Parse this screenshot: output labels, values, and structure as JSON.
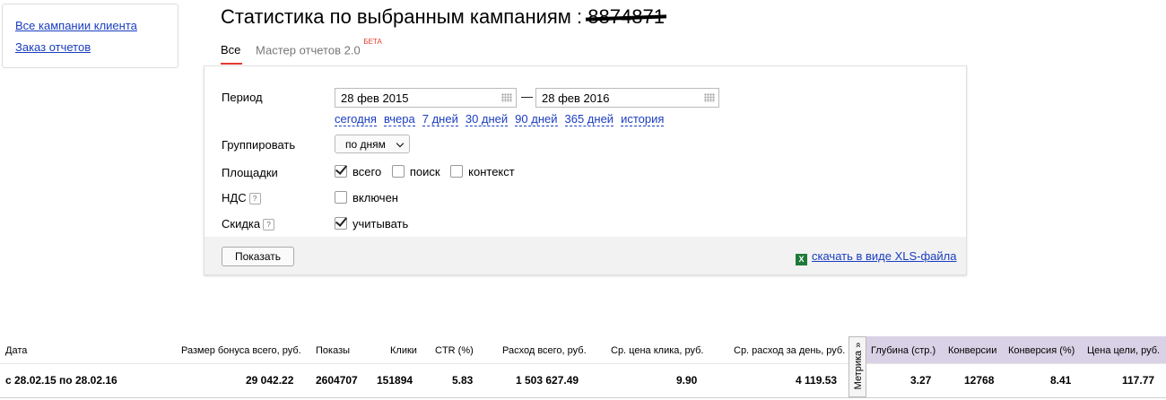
{
  "sidebar": {
    "links": [
      "Все кампании клиента",
      "Заказ отчетов"
    ]
  },
  "header": {
    "title": "Статистика по выбранным кампаниям :",
    "redacted_id": "8874871"
  },
  "tabs": {
    "active": "Все",
    "master": "Мастер отчетов 2.0",
    "master_badge": "БЕТА"
  },
  "form": {
    "period_label": "Период",
    "date_from": "28 фев 2015",
    "date_to": "28 фев 2016",
    "dash": "—",
    "quick_links": [
      "сегодня",
      "вчера",
      "7 дней",
      "30 дней",
      "90 дней",
      "365 дней",
      "история"
    ],
    "group_label": "Группировать",
    "group_value": "по дням",
    "platforms_label": "Площадки",
    "platforms": [
      {
        "label": "всего",
        "checked": true
      },
      {
        "label": "поиск",
        "checked": false
      },
      {
        "label": "контекст",
        "checked": false
      }
    ],
    "vat_label": "НДС",
    "vat_option": "включен",
    "discount_label": "Скидка",
    "discount_option": "учитывать",
    "help_glyph": "?",
    "show_button": "Показать",
    "xls_link": "скачать в виде XLS-файла",
    "xls_icon": "X"
  },
  "stats": {
    "headers": [
      "Дата",
      "Размер бонуса всего, руб.",
      "Показы",
      "Клики",
      "CTR (%)",
      "Расход всего, руб.",
      "Ср. цена клика, руб.",
      "Ср. расход за день, руб.",
      "Глубина (стр.)",
      "Конверсии",
      "Конверсия (%)",
      "Цена цели, руб."
    ],
    "row": [
      "с 28.02.15 по 28.02.16",
      "29 042.22",
      "2604707",
      "151894",
      "5.83",
      "1 503 627.49",
      "9.90",
      "4 119.53",
      "3.27",
      "12768",
      "8.41",
      "117.77"
    ],
    "metrika_tab": "Метрика »",
    "metrika_color": "#d9d2e6"
  }
}
